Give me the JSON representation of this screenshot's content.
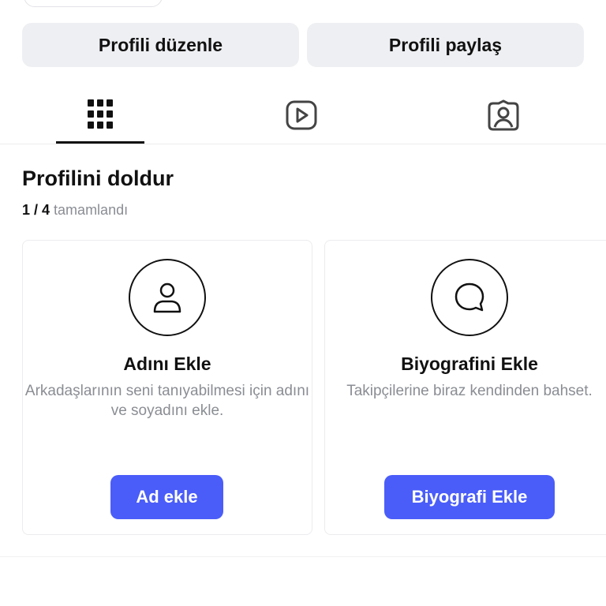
{
  "actions": {
    "edit_profile": "Profili düzenle",
    "share_profile": "Profili paylaş"
  },
  "tabs": [
    {
      "icon": "grid-icon",
      "active": true
    },
    {
      "icon": "reels-icon",
      "active": false
    },
    {
      "icon": "tagged-icon",
      "active": false
    }
  ],
  "complete_profile": {
    "title": "Profilini doldur",
    "progress_count": "1 / 4",
    "progress_label": "tamamlandı"
  },
  "cards": [
    {
      "icon": "person-icon",
      "title": "Adını Ekle",
      "description": "Arkadaşlarının seni tanıyabilmesi için adını ve soyadını ekle.",
      "button": "Ad ekle"
    },
    {
      "icon": "speech-bubble-icon",
      "title": "Biyografini Ekle",
      "description": "Takipçilerine biraz kendinden bahset.",
      "button": "Biyografi Ekle"
    }
  ],
  "colors": {
    "accent": "#4a5df9",
    "secondary_button_bg": "#eeeff2",
    "muted_text": "#8a8d93"
  }
}
